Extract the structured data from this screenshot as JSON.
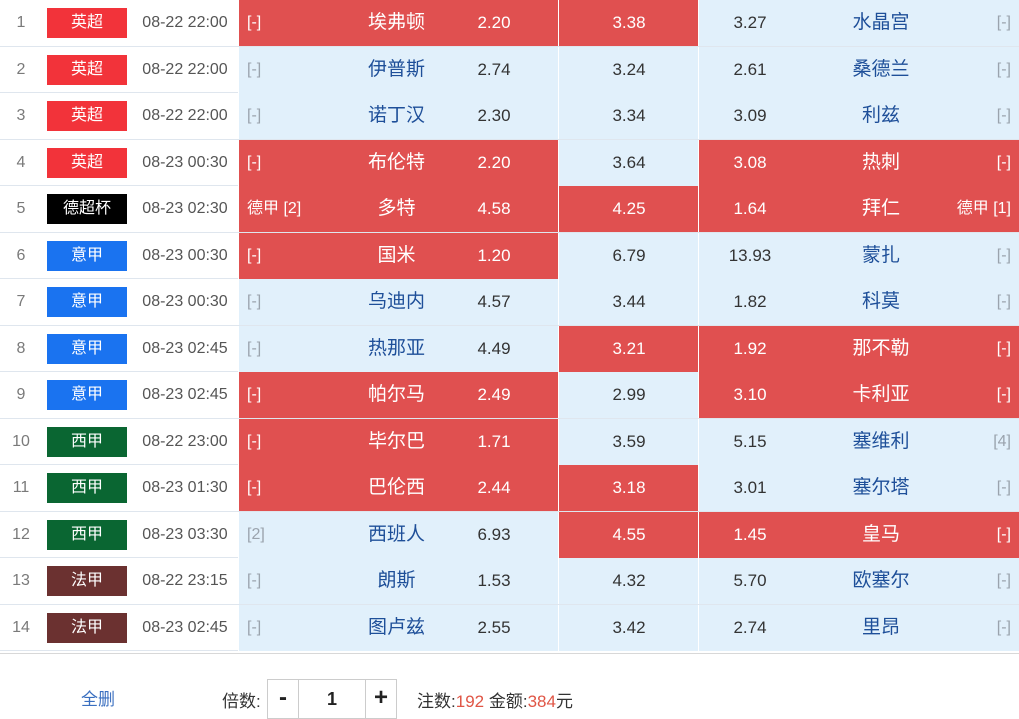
{
  "colors": {
    "selected": "#e05050",
    "unselected": "#e1f0fb",
    "leagues": {
      "英超": "#f2333a",
      "德超杯": "#000000",
      "意甲": "#1a73f0",
      "西甲": "#0a6632",
      "法甲": "#6b3130"
    }
  },
  "matches": [
    {
      "no": "1",
      "league": "英超",
      "time": "08-22 22:00",
      "home_rank": "[-]",
      "home": "埃弗顿",
      "win": "2.20",
      "draw": "3.38",
      "lose": "3.27",
      "away": "水晶宫",
      "away_rank": "[-]",
      "selected": {
        "home": true,
        "draw": true,
        "away": false
      }
    },
    {
      "no": "2",
      "league": "英超",
      "time": "08-22 22:00",
      "home_rank": "[-]",
      "home": "伊普斯",
      "win": "2.74",
      "draw": "3.24",
      "lose": "2.61",
      "away": "桑德兰",
      "away_rank": "[-]",
      "selected": {
        "home": false,
        "draw": false,
        "away": false
      }
    },
    {
      "no": "3",
      "league": "英超",
      "time": "08-22 22:00",
      "home_rank": "[-]",
      "home": "诺丁汉",
      "win": "2.30",
      "draw": "3.34",
      "lose": "3.09",
      "away": "利兹",
      "away_rank": "[-]",
      "selected": {
        "home": false,
        "draw": false,
        "away": false
      }
    },
    {
      "no": "4",
      "league": "英超",
      "time": "08-23 00:30",
      "home_rank": "[-]",
      "home": "布伦特",
      "win": "2.20",
      "draw": "3.64",
      "lose": "3.08",
      "away": "热刺",
      "away_rank": "[-]",
      "selected": {
        "home": true,
        "draw": false,
        "away": true
      }
    },
    {
      "no": "5",
      "league": "德超杯",
      "time": "08-23 02:30",
      "home_rank": "德甲 [2]",
      "home": "多特",
      "win": "4.58",
      "draw": "4.25",
      "lose": "1.64",
      "away": "拜仁",
      "away_rank": "德甲 [1]",
      "selected": {
        "home": true,
        "draw": true,
        "away": true
      }
    },
    {
      "no": "6",
      "league": "意甲",
      "time": "08-23 00:30",
      "home_rank": "[-]",
      "home": "国米",
      "win": "1.20",
      "draw": "6.79",
      "lose": "13.93",
      "away": "蒙扎",
      "away_rank": "[-]",
      "selected": {
        "home": true,
        "draw": false,
        "away": false
      }
    },
    {
      "no": "7",
      "league": "意甲",
      "time": "08-23 00:30",
      "home_rank": "[-]",
      "home": "乌迪内",
      "win": "4.57",
      "draw": "3.44",
      "lose": "1.82",
      "away": "科莫",
      "away_rank": "[-]",
      "selected": {
        "home": false,
        "draw": false,
        "away": false
      }
    },
    {
      "no": "8",
      "league": "意甲",
      "time": "08-23 02:45",
      "home_rank": "[-]",
      "home": "热那亚",
      "win": "4.49",
      "draw": "3.21",
      "lose": "1.92",
      "away": "那不勒",
      "away_rank": "[-]",
      "selected": {
        "home": false,
        "draw": true,
        "away": true
      }
    },
    {
      "no": "9",
      "league": "意甲",
      "time": "08-23 02:45",
      "home_rank": "[-]",
      "home": "帕尔马",
      "win": "2.49",
      "draw": "2.99",
      "lose": "3.10",
      "away": "卡利亚",
      "away_rank": "[-]",
      "selected": {
        "home": true,
        "draw": false,
        "away": true
      }
    },
    {
      "no": "10",
      "league": "西甲",
      "time": "08-22 23:00",
      "home_rank": "[-]",
      "home": "毕尔巴",
      "win": "1.71",
      "draw": "3.59",
      "lose": "5.15",
      "away": "塞维利",
      "away_rank": "[4]",
      "selected": {
        "home": true,
        "draw": false,
        "away": false
      }
    },
    {
      "no": "11",
      "league": "西甲",
      "time": "08-23 01:30",
      "home_rank": "[-]",
      "home": "巴伦西",
      "win": "2.44",
      "draw": "3.18",
      "lose": "3.01",
      "away": "塞尔塔",
      "away_rank": "[-]",
      "selected": {
        "home": true,
        "draw": true,
        "away": false
      }
    },
    {
      "no": "12",
      "league": "西甲",
      "time": "08-23 03:30",
      "home_rank": "[2]",
      "home": "西班人",
      "win": "6.93",
      "draw": "4.55",
      "lose": "1.45",
      "away": "皇马",
      "away_rank": "[-]",
      "selected": {
        "home": false,
        "draw": true,
        "away": true
      }
    },
    {
      "no": "13",
      "league": "法甲",
      "time": "08-22 23:15",
      "home_rank": "[-]",
      "home": "朗斯",
      "win": "1.53",
      "draw": "4.32",
      "lose": "5.70",
      "away": "欧塞尔",
      "away_rank": "[-]",
      "selected": {
        "home": false,
        "draw": false,
        "away": false
      }
    },
    {
      "no": "14",
      "league": "法甲",
      "time": "08-23 02:45",
      "home_rank": "[-]",
      "home": "图卢兹",
      "win": "2.55",
      "draw": "3.42",
      "lose": "2.74",
      "away": "里昂",
      "away_rank": "[-]",
      "selected": {
        "home": false,
        "draw": false,
        "away": false
      }
    }
  ],
  "footer": {
    "clear_label": "全删",
    "multiplier_label": "倍数:",
    "minus_label": "-",
    "multiplier_value": "1",
    "plus_label": "+",
    "bets_label": "注数:",
    "bets_count": "192",
    "amount_label": "金额:",
    "amount_value": "384",
    "currency": "元"
  }
}
